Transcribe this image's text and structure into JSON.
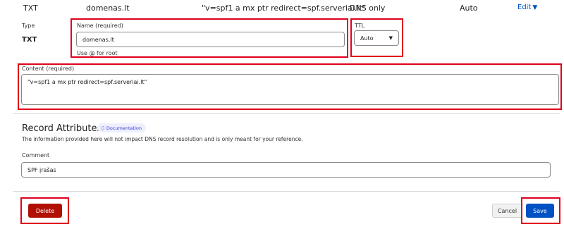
{
  "record_row": {
    "type": "TXT",
    "name": "domenas.lt",
    "content": "\"v=spf1 a mx ptr redirect=spf.serveriai.lt\"",
    "proxy_status": "DNS only",
    "ttl": "Auto",
    "edit_label": "Edit"
  },
  "form": {
    "type_label": "Type",
    "type_value": "TXT",
    "name_label": "Name (required)",
    "name_value": "domenas.lt",
    "name_hint": "Use @ for root",
    "ttl_label": "TTL",
    "ttl_value": "Auto",
    "content_label": "Content (required)",
    "content_value": "\"v=spf1 a mx ptr redirect=spf.serveriai.lt\""
  },
  "attributes": {
    "title": "Record Attributes",
    "doc_label": "Documentation",
    "description": "The information provided here will not impact DNS record resolution and is only meant for your reference.",
    "comment_label": "Comment",
    "comment_value": "SPF įrašas"
  },
  "actions": {
    "delete_label": "Delete",
    "cancel_label": "Cancel",
    "save_label": "Save"
  },
  "colors": {
    "accent": "#0051c3",
    "danger": "#b20f03",
    "highlight": "#e0001b"
  }
}
